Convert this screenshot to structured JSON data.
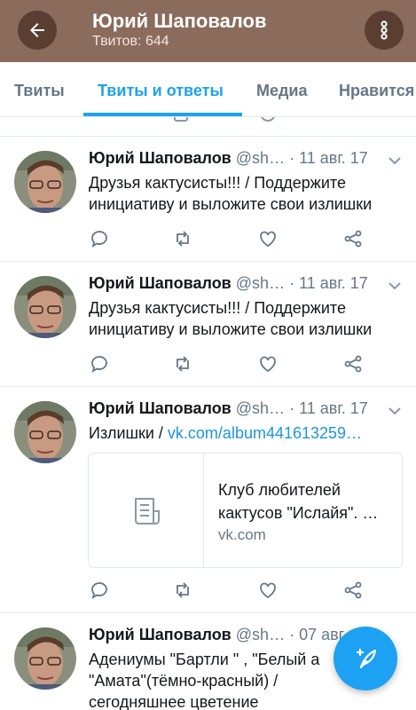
{
  "header": {
    "title": "Юрий Шаповалов",
    "subtitle": "Твитов: 644",
    "back_icon": "arrow-left-icon",
    "more_icon": "more-vertical-icon",
    "color": "#8b6b5c"
  },
  "tabs": [
    {
      "label": "Твиты",
      "active": false
    },
    {
      "label": "Твиты и ответы",
      "active": true
    },
    {
      "label": "Медиа",
      "active": false
    },
    {
      "label": "Нравится",
      "active": false
    }
  ],
  "tweets": [
    {
      "name": "Юрий Шаповалов",
      "handle": "@sh…",
      "date": "· 11 авг. 17",
      "text": "Друзья кактусисты!!! / Поддержите инициативу и выложите свои излишки"
    },
    {
      "name": "Юрий Шаповалов",
      "handle": "@sh…",
      "date": "· 11 авг. 17",
      "text": "Друзья кактусисты!!! / Поддержите инициативу и выложите свои излишки"
    },
    {
      "name": "Юрий Шаповалов",
      "handle": "@sh…",
      "date": "· 11 авг. 17",
      "text_prefix": "Излишки / ",
      "link": "vk.com/album441613259…",
      "card": {
        "title": "Клуб любителей кактусов \"Ислайя\". …",
        "domain": "vk.com"
      }
    },
    {
      "name": "Юрий Шаповалов",
      "handle": "@sh…",
      "date": "· 07 авг.",
      "text": "Адениумы \"Бартли \" , \"Белый а \"Амата\"(тёмно-красный) / сегодняшнее цветение"
    }
  ],
  "colors": {
    "accent": "#1da1f2",
    "link": "#1b95e0",
    "muted": "#657786"
  }
}
